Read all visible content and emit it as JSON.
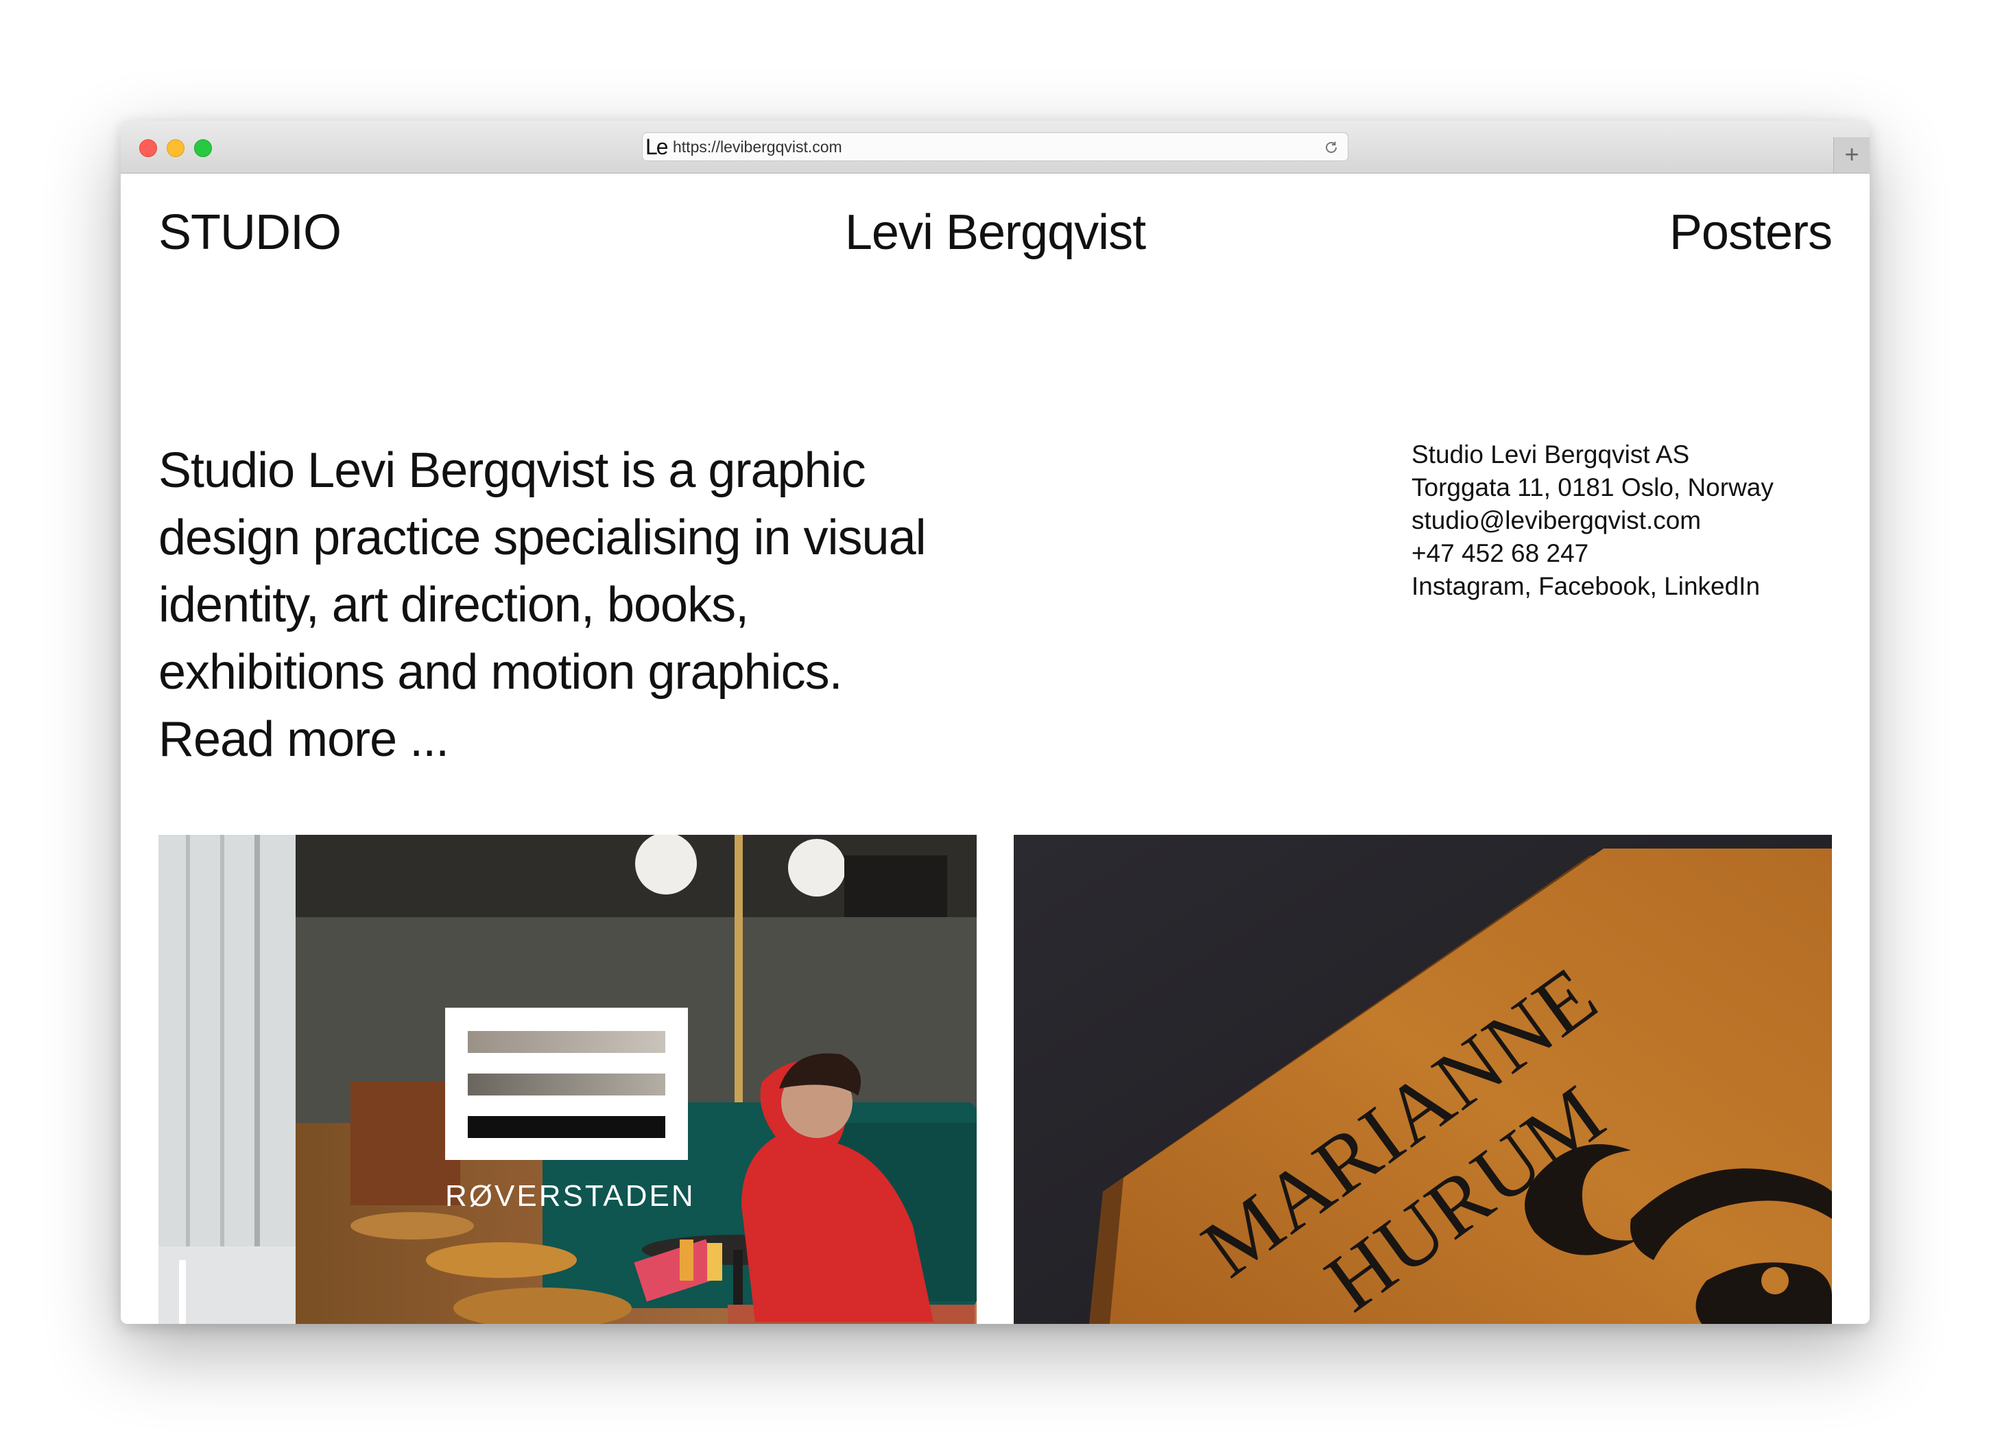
{
  "browser": {
    "url": "https://levibergqvist.com",
    "favicon_text": "Le",
    "new_tab_symbol": "+"
  },
  "nav": {
    "left": "STUDIO",
    "center": "Levi Bergqvist",
    "right": "Posters"
  },
  "intro": {
    "text": "Studio Levi Bergqvist is a graphic design practice specialising in visual identity, art direction, books, exhibitions and motion graphics.",
    "read_more": "Read more ..."
  },
  "contact": {
    "company": "Studio Levi Bergqvist AS",
    "address": "Torggata 11, 0181 Oslo, Norway",
    "email": "studio@levibergqvist.com",
    "phone": "+47 452 68 247",
    "social": [
      "Instagram",
      "Facebook",
      "LinkedIn"
    ]
  },
  "projects": [
    {
      "logo_text": "RØVERSTADEN"
    },
    {
      "book_lines": [
        "MARIANNE",
        "HURUM"
      ]
    }
  ]
}
